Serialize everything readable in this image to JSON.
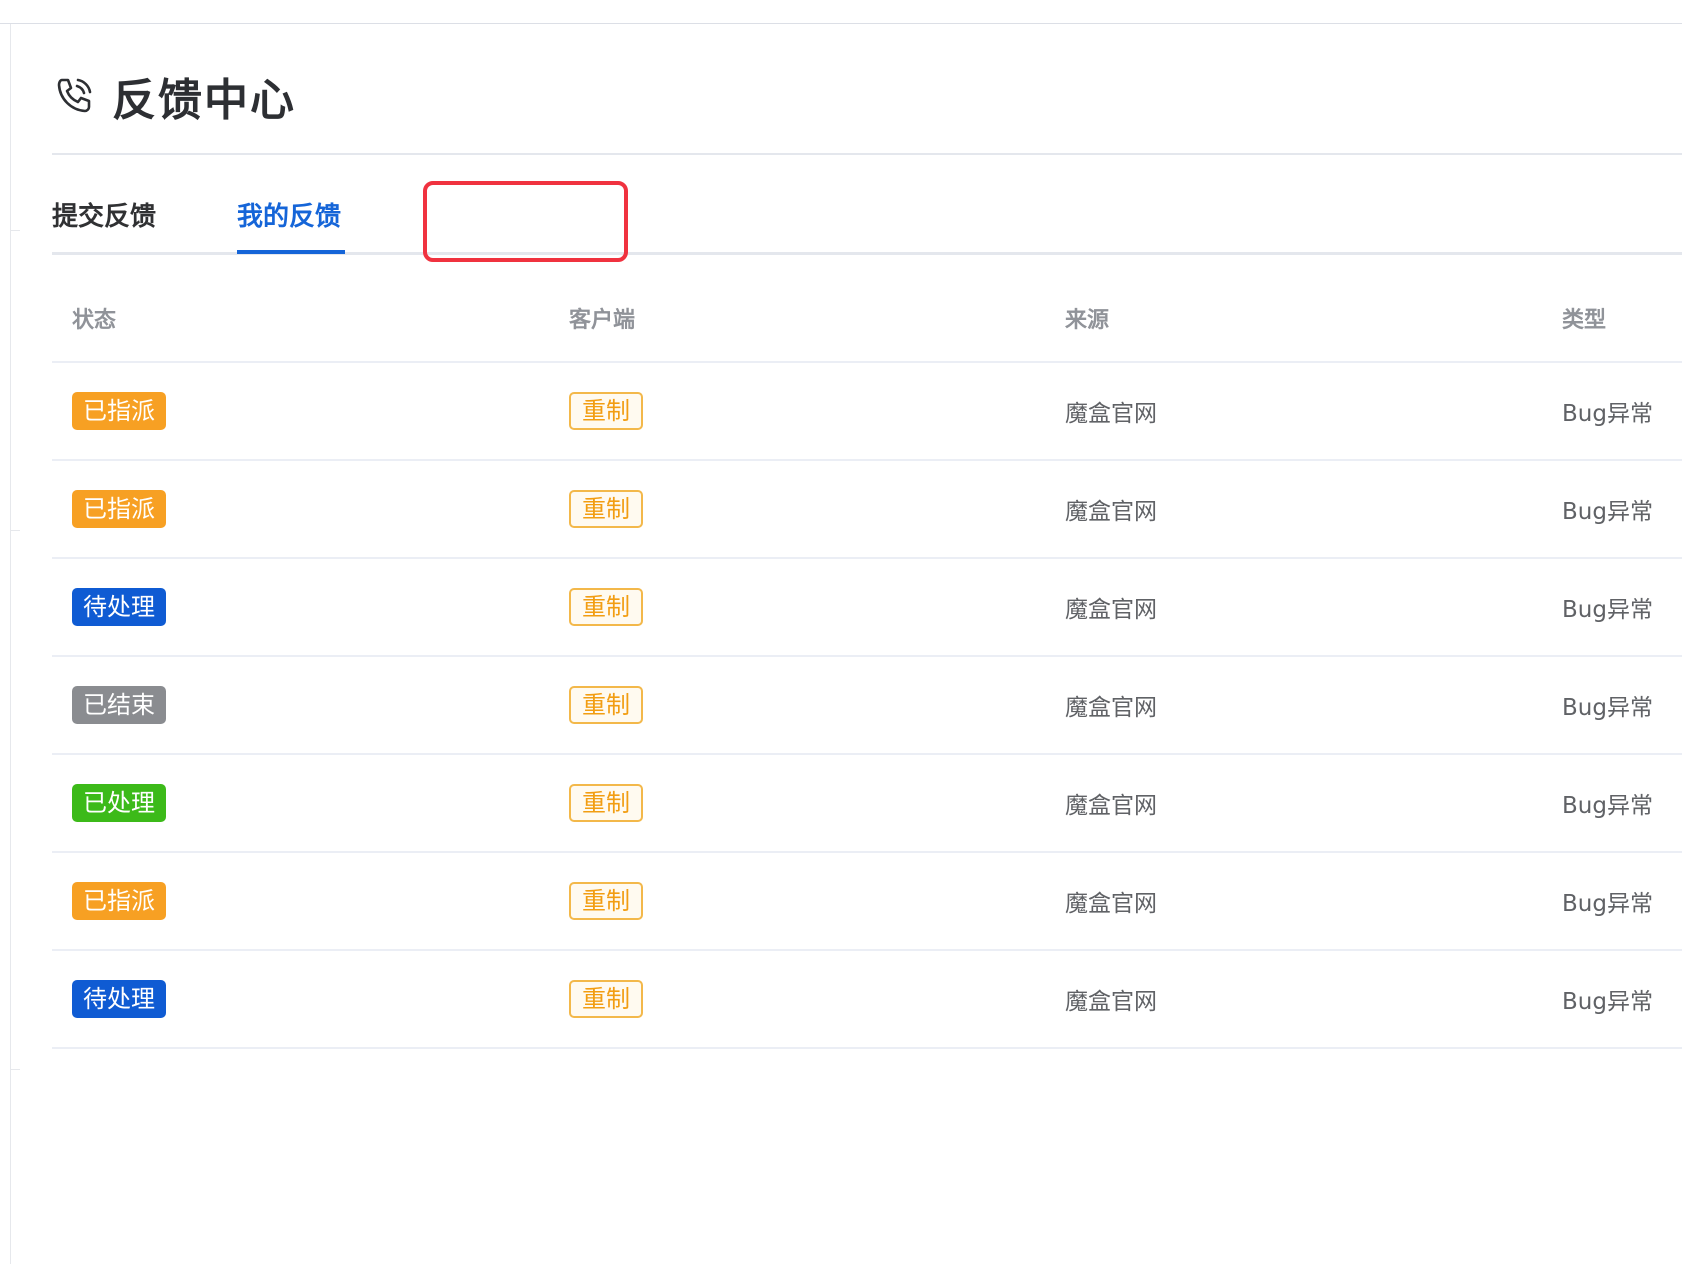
{
  "colors": {
    "primary": "#1565d8",
    "assigned": "#f7a023",
    "pending": "#0f5bd3",
    "closed": "#8a8c90",
    "processed": "#3cba19",
    "client_tag": "#f29d12",
    "highlight": "#f0323f"
  },
  "page": {
    "icon": "phone-icon",
    "title": "反馈中心"
  },
  "tabs": [
    {
      "label": "提交反馈",
      "active": false
    },
    {
      "label": "我的反馈",
      "active": true
    }
  ],
  "table": {
    "headers": [
      "状态",
      "客户端",
      "来源",
      "类型"
    ],
    "rows": [
      {
        "status": "已指派",
        "status_kind": "assigned",
        "client": "重制",
        "source": "魔盒官网",
        "type": "Bug异常"
      },
      {
        "status": "已指派",
        "status_kind": "assigned",
        "client": "重制",
        "source": "魔盒官网",
        "type": "Bug异常"
      },
      {
        "status": "待处理",
        "status_kind": "pending",
        "client": "重制",
        "source": "魔盒官网",
        "type": "Bug异常"
      },
      {
        "status": "已结束",
        "status_kind": "closed",
        "client": "重制",
        "source": "魔盒官网",
        "type": "Bug异常"
      },
      {
        "status": "已处理",
        "status_kind": "processed",
        "client": "重制",
        "source": "魔盒官网",
        "type": "Bug异常"
      },
      {
        "status": "已指派",
        "status_kind": "assigned",
        "client": "重制",
        "source": "魔盒官网",
        "type": "Bug异常"
      },
      {
        "status": "待处理",
        "status_kind": "pending",
        "client": "重制",
        "source": "魔盒官网",
        "type": "Bug异常"
      }
    ]
  }
}
